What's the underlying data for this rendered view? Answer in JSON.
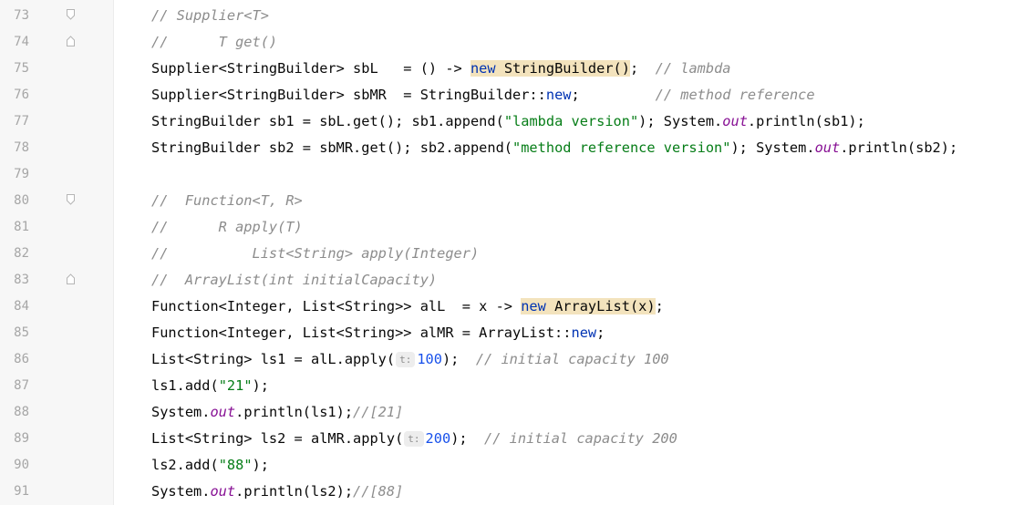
{
  "editor": {
    "lines": [
      {
        "n": "73",
        "fold": "start",
        "tokens": [
          {
            "t": "// Supplier<T>",
            "k": "com"
          }
        ]
      },
      {
        "n": "74",
        "fold": "end",
        "tokens": [
          {
            "t": "//      T get()",
            "k": "com"
          }
        ]
      },
      {
        "n": "75",
        "tokens": [
          {
            "t": "Supplier<StringBuilder> sbL   = () -> ",
            "k": "txt"
          },
          {
            "t": "new",
            "k": "kw",
            "hl": true
          },
          {
            "t": " ",
            "k": "txt",
            "hl": true
          },
          {
            "t": "StringBuilder()",
            "k": "txt",
            "hl": true
          },
          {
            "t": ";  ",
            "k": "txt"
          },
          {
            "t": "// lambda",
            "k": "com"
          }
        ]
      },
      {
        "n": "76",
        "tokens": [
          {
            "t": "Supplier<StringBuilder> sbMR  = StringBuilder::",
            "k": "txt"
          },
          {
            "t": "new",
            "k": "kw"
          },
          {
            "t": ";         ",
            "k": "txt"
          },
          {
            "t": "// method reference",
            "k": "com"
          }
        ]
      },
      {
        "n": "77",
        "tokens": [
          {
            "t": "StringBuilder sb1 = sbL.get(); sb1.append(",
            "k": "txt"
          },
          {
            "t": "\"lambda version\"",
            "k": "str"
          },
          {
            "t": "); System.",
            "k": "txt"
          },
          {
            "t": "out",
            "k": "field"
          },
          {
            "t": ".println(sb1);",
            "k": "txt"
          }
        ]
      },
      {
        "n": "78",
        "tokens": [
          {
            "t": "StringBuilder sb2 = sbMR.get(); sb2.append(",
            "k": "txt"
          },
          {
            "t": "\"method reference version\"",
            "k": "str"
          },
          {
            "t": "); System.",
            "k": "txt"
          },
          {
            "t": "out",
            "k": "field"
          },
          {
            "t": ".println(sb2);",
            "k": "txt"
          }
        ]
      },
      {
        "n": "79",
        "tokens": []
      },
      {
        "n": "80",
        "fold": "start",
        "tokens": [
          {
            "t": "//  Function<T, R>",
            "k": "com"
          }
        ]
      },
      {
        "n": "81",
        "tokens": [
          {
            "t": "//      R apply(T)",
            "k": "com"
          }
        ]
      },
      {
        "n": "82",
        "tokens": [
          {
            "t": "//          List<String> apply(Integer)",
            "k": "com"
          }
        ]
      },
      {
        "n": "83",
        "fold": "end",
        "tokens": [
          {
            "t": "//  ArrayList(int initialCapacity)",
            "k": "com"
          }
        ]
      },
      {
        "n": "84",
        "tokens": [
          {
            "t": "Function<Integer, List<String>> alL  = x -> ",
            "k": "txt"
          },
          {
            "t": "new",
            "k": "kw",
            "hl": true
          },
          {
            "t": " ",
            "k": "txt",
            "hl": true
          },
          {
            "t": "ArrayList(x)",
            "k": "txt",
            "hl": true
          },
          {
            "t": ";",
            "k": "txt"
          }
        ]
      },
      {
        "n": "85",
        "tokens": [
          {
            "t": "Function<Integer, List<String>> alMR = ArrayList::",
            "k": "txt"
          },
          {
            "t": "new",
            "k": "kw"
          },
          {
            "t": ";",
            "k": "txt"
          }
        ]
      },
      {
        "n": "86",
        "tokens": [
          {
            "t": "List<String> ls1 = alL.apply(",
            "k": "txt"
          },
          {
            "t": "t:",
            "k": "hint"
          },
          {
            "t": "100",
            "k": "num"
          },
          {
            "t": ");  ",
            "k": "txt"
          },
          {
            "t": "// initial capacity 100",
            "k": "com"
          }
        ]
      },
      {
        "n": "87",
        "tokens": [
          {
            "t": "ls1.add(",
            "k": "txt"
          },
          {
            "t": "\"21\"",
            "k": "str"
          },
          {
            "t": ");",
            "k": "txt"
          }
        ]
      },
      {
        "n": "88",
        "tokens": [
          {
            "t": "System.",
            "k": "txt"
          },
          {
            "t": "out",
            "k": "field"
          },
          {
            "t": ".println(ls1);",
            "k": "txt"
          },
          {
            "t": "//[21]",
            "k": "com"
          }
        ]
      },
      {
        "n": "89",
        "tokens": [
          {
            "t": "List<String> ls2 = alMR.apply(",
            "k": "txt"
          },
          {
            "t": "t:",
            "k": "hint"
          },
          {
            "t": "200",
            "k": "num"
          },
          {
            "t": ");  ",
            "k": "txt"
          },
          {
            "t": "// initial capacity 200",
            "k": "com"
          }
        ]
      },
      {
        "n": "90",
        "tokens": [
          {
            "t": "ls2.add(",
            "k": "txt"
          },
          {
            "t": "\"88\"",
            "k": "str"
          },
          {
            "t": ");",
            "k": "txt"
          }
        ]
      },
      {
        "n": "91",
        "tokens": [
          {
            "t": "System.",
            "k": "txt"
          },
          {
            "t": "out",
            "k": "field"
          },
          {
            "t": ".println(ls2);",
            "k": "txt"
          },
          {
            "t": "//[88]",
            "k": "com"
          }
        ]
      }
    ],
    "colors": {
      "comment": "#8c8c8c",
      "keyword": "#0033b3",
      "number": "#1750eb",
      "string": "#067d17",
      "field": "#871094",
      "highlight": "#f3e3bd",
      "gutter": "#f7f7f7"
    },
    "icons": {
      "fold_start": "fold-start-icon",
      "fold_end": "fold-end-icon"
    }
  }
}
